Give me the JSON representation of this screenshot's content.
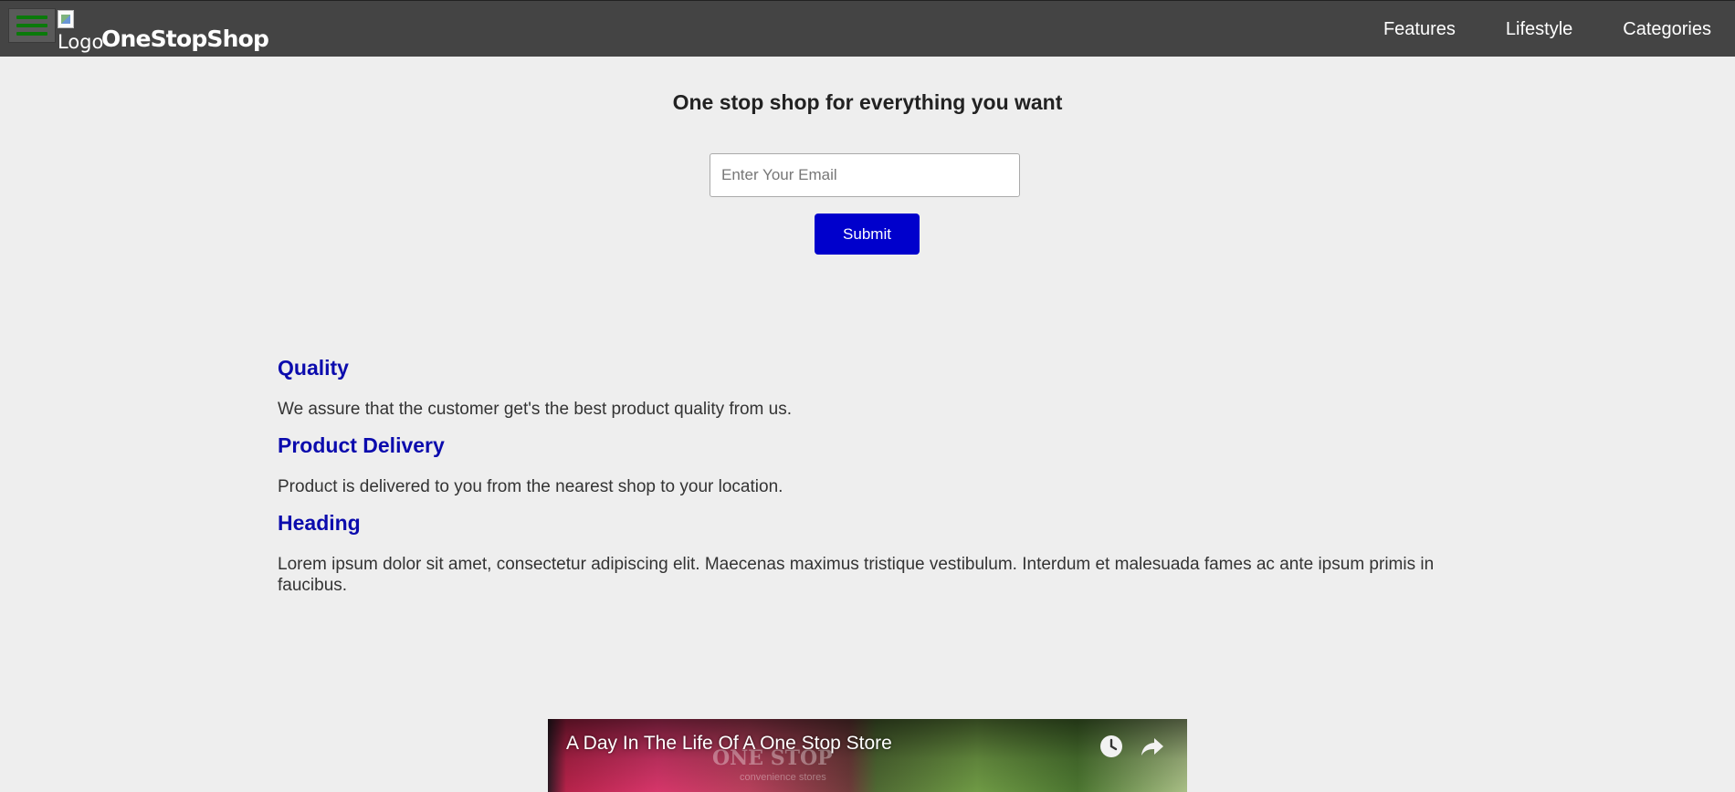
{
  "header": {
    "menu_icon": "hamburger-icon",
    "logo_alt": "Logo",
    "brand": "OneStopShop",
    "nav": [
      {
        "label": "Features"
      },
      {
        "label": "Lifestyle"
      },
      {
        "label": "Categories"
      }
    ]
  },
  "hero": {
    "title": "One stop shop for everything you want",
    "email_placeholder": "Enter Your Email",
    "submit_label": "Submit"
  },
  "features": [
    {
      "heading": "Quality",
      "text": "We assure that the customer get's the best product quality from us."
    },
    {
      "heading": "Product Delivery",
      "text": "Product is delivered to you from the nearest shop to your location."
    },
    {
      "heading": "Heading",
      "text": "Lorem ipsum dolor sit amet, consectetur adipiscing elit. Maecenas maximus tristique vestibulum. Interdum et malesuada fames ac ante ipsum primis in faucibus."
    }
  ],
  "video": {
    "title": "A Day In The Life Of A One Stop Store",
    "sign_text": "ONE STOP",
    "sign_subtext": "convenience stores",
    "icons": [
      "watch-later-icon",
      "share-icon"
    ]
  },
  "colors": {
    "header_bg": "#444444",
    "page_bg": "#eeeeee",
    "accent_blue": "#0000cc",
    "heading_blue": "#0b0bad",
    "menu_green": "#0a7a0a"
  }
}
